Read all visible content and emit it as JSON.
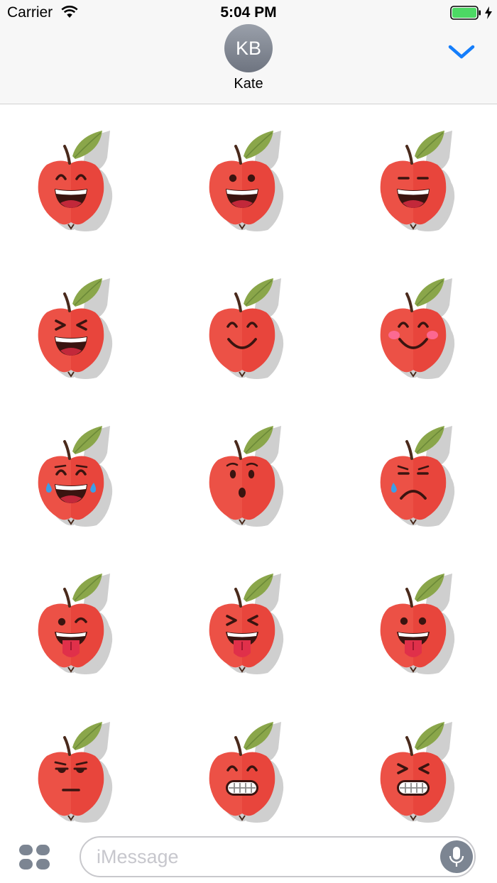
{
  "status_bar": {
    "carrier": "Carrier",
    "time": "5:04 PM",
    "icons": [
      "wifi-icon",
      "battery-icon",
      "charging-bolt-icon"
    ],
    "battery_color": "#4cd964"
  },
  "header": {
    "avatar_initials": "KB",
    "contact_name": "Kate",
    "collapse_icon": "chevron-down-icon",
    "accent_color": "#157efb"
  },
  "stickers": [
    {
      "name": "sticker-happy-smile-teeth",
      "eyes": "arc",
      "mouth": "grin-teeth",
      "extra": "none"
    },
    {
      "name": "sticker-grin-dot-eyes",
      "eyes": "dot",
      "mouth": "grin-teeth",
      "extra": "none"
    },
    {
      "name": "sticker-grin-flat-eyes",
      "eyes": "flat",
      "mouth": "grin-teeth",
      "extra": "none"
    },
    {
      "name": "sticker-squint-laugh",
      "eyes": "squint",
      "mouth": "grin-teeth",
      "extra": "none"
    },
    {
      "name": "sticker-smile",
      "eyes": "arc",
      "mouth": "smile",
      "extra": "none"
    },
    {
      "name": "sticker-blush-smile",
      "eyes": "arc",
      "mouth": "smile",
      "extra": "blush"
    },
    {
      "name": "sticker-tears-of-joy",
      "eyes": "arc",
      "mouth": "grin-teeth",
      "extra": "tears"
    },
    {
      "name": "sticker-surprised",
      "eyes": "oval",
      "mouth": "o",
      "extra": "brows"
    },
    {
      "name": "sticker-sad-tear",
      "eyes": "flat",
      "mouth": "frown",
      "extra": "tear"
    },
    {
      "name": "sticker-wink-tongue",
      "eyes": "wink",
      "mouth": "tongue",
      "extra": "none"
    },
    {
      "name": "sticker-squint-tongue",
      "eyes": "squint",
      "mouth": "tongue",
      "extra": "none"
    },
    {
      "name": "sticker-dot-tongue",
      "eyes": "dot",
      "mouth": "tongue",
      "extra": "none"
    },
    {
      "name": "sticker-unamused",
      "eyes": "half",
      "mouth": "flat",
      "extra": "none"
    },
    {
      "name": "sticker-grimace",
      "eyes": "arc",
      "mouth": "grimace",
      "extra": "none"
    },
    {
      "name": "sticker-squint-grimace",
      "eyes": "squint",
      "mouth": "grimace",
      "extra": "none"
    }
  ],
  "sticker_colors": {
    "apple": "#e8453c",
    "apple_light": "#ef5b4f",
    "shadow": "#cfcfcf",
    "leaf": "#8aa64a",
    "leaf_dark": "#6c8a38",
    "stem": "#4a2a1c",
    "blush": "#ff6fa0",
    "tear": "#3b9ee8"
  },
  "input_bar": {
    "apps_icon": "app-drawer-icon",
    "placeholder": "iMessage",
    "mic_icon": "microphone-icon"
  }
}
